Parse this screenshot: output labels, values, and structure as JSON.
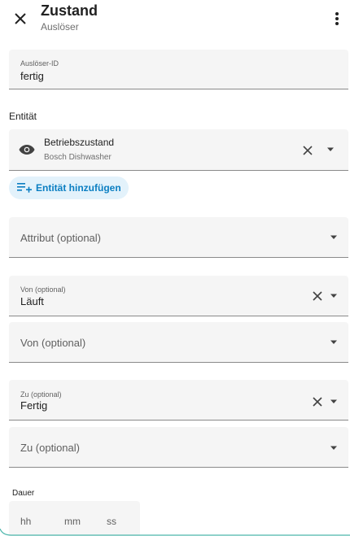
{
  "header": {
    "title": "Zustand",
    "subtitle": "Auslöser",
    "close_icon": "close-icon",
    "more_icon": "more-vert-icon"
  },
  "trigger_id": {
    "label": "Auslöser-ID",
    "value": "fertig"
  },
  "entity_section": {
    "label": "Entität",
    "entity_name": "Betriebszustand",
    "entity_device": "Bosch Dishwasher",
    "add_label": "Entität hinzufügen"
  },
  "attribute": {
    "placeholder": "Attribut (optional)"
  },
  "from_state": {
    "label": "Von (optional)",
    "value": "Läuft"
  },
  "from_attribute": {
    "placeholder": "Von (optional)"
  },
  "to_state": {
    "label": "Zu (optional)",
    "value": "Fertig"
  },
  "to_attribute": {
    "placeholder": "Zu (optional)"
  },
  "duration": {
    "label": "Dauer",
    "hours_placeholder": "hh",
    "minutes_placeholder": "mm",
    "seconds_placeholder": "ss"
  },
  "colors": {
    "accent": "#0a7ec2",
    "chip_bg": "#e3f2fb",
    "field_bg": "#f5f5f5"
  }
}
